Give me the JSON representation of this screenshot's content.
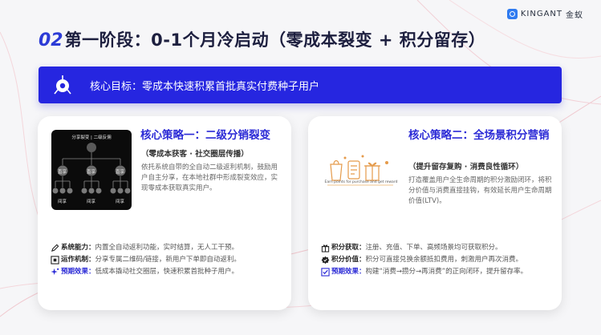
{
  "header": {
    "title_num": "02",
    "title_text": "第一阶段：0-1个月冷启动（零成本裂变 + 积分留存）",
    "logo_text": "KINGANT",
    "logo_cn": "金蚁"
  },
  "banner": {
    "text": "核心目标：零成本快速积累首批真实付费种子用户",
    "icon": "target-icon",
    "color": "#2626e0"
  },
  "card1": {
    "title": "核心策略一：二级分销裂变",
    "subtitle": "（零成本获客 · 社交圈层传播）",
    "description": "依托系统自带的全自动二级返利机制，鼓励用户自主分享，在本地社群中形成裂变效应，实现零成本获取真实用户。",
    "diagram": {
      "header": "分享裂变 | 二级反佣",
      "level1_label": "直享",
      "level2_label": "间享"
    },
    "bullets": [
      {
        "icon": "pen-icon",
        "key": "系统能力",
        "value": "内置全自动返利功能，实时结算，无人工干预。"
      },
      {
        "icon": "qrcode-icon",
        "key": "运作机制",
        "value": "分享专属二维码/链接，新用户下单即自动返利。"
      },
      {
        "icon": "sparkle-icon",
        "key": "预期效果",
        "value": "低成本撬动社交圈层，快速积累首批种子用户。",
        "highlight": true
      }
    ]
  },
  "card2": {
    "title": "核心策略二：全场景积分营销",
    "subtitle": "（提升留存复购 · 消费良性循环）",
    "description": "打造覆盖用户全生命周期的积分激励闭环，将积分价值与消费直接挂钩，有效延长用户生命周期价值(LTV)。",
    "illustration_caption": "Earn points for purchase and get reward",
    "bullets": [
      {
        "icon": "gift-icon",
        "key": "积分获取",
        "value": "注册、充值、下单、高频场景均可获取积分。"
      },
      {
        "icon": "badge-icon",
        "key": "积分价值",
        "value": "积分可直接兑换余额抵扣费用，刺激用户再次消费。"
      },
      {
        "icon": "checkbox-icon",
        "key": "预期效果",
        "value": "构建“消费→攒分→再消费”的正向闭环，提升留存率。",
        "highlight": true
      }
    ]
  },
  "colors": {
    "accent": "#2b2ad6",
    "title_num": "#2c3bd6"
  }
}
